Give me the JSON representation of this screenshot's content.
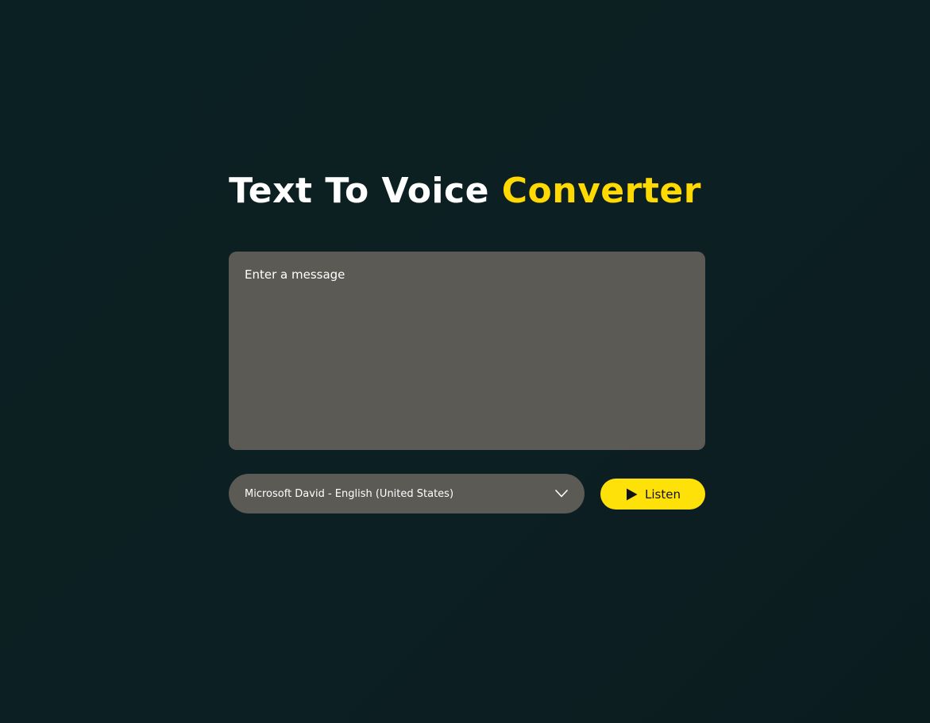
{
  "header": {
    "title_part1": "Text To Voice",
    "title_part2": "Converter"
  },
  "message": {
    "placeholder": "Enter a message",
    "value": ""
  },
  "voice_select": {
    "selected": "Microsoft David - English (United States)",
    "icon": "chevron-down-icon"
  },
  "listen_button": {
    "label": "Listen",
    "icon": "play-icon"
  },
  "colors": {
    "background": "#0c1f22",
    "accent": "#ffe10a",
    "panel": "#5b5a55",
    "text": "#ffffff"
  }
}
